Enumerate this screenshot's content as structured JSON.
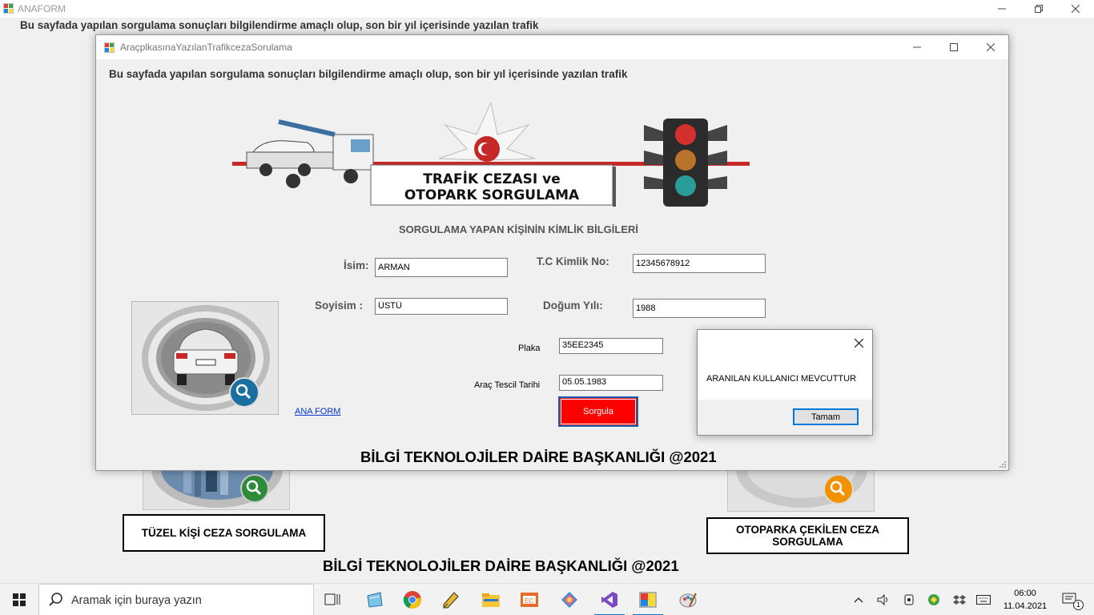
{
  "parent_window": {
    "title": "ANAFORM",
    "description": "Bu sayfada yapılan sorgulama sonuçları bilgilendirme amaçlı olup, son bir yıl içerisinde yazılan trafik",
    "tiles": {
      "tuzel_label": "TÜZEL KİŞİ CEZA SORGULAMA",
      "otopark_label": "OTOPARKA ÇEKİLEN CEZA SORGULAMA"
    },
    "footer": "BİLGİ TEKNOLOJİLER DAİRE BAŞKANLIĞI @2021"
  },
  "child_window": {
    "title": "AraçplkasınaYazılanTrafikcezaSorulama",
    "description": "Bu sayfada yapılan sorgulama sonuçları bilgilendirme amaçlı olup, son bir yıl içerisinde yazılan trafik",
    "banner": {
      "line1": "TRAFİK CEZASI ve",
      "line2": "OTOPARK SORGULAMA"
    },
    "section_title": "SORGULAMA YAPAN KİŞİNİN KİMLİK BİLGİLERİ",
    "form": {
      "isim_label": "İsim:",
      "isim_value": "ARMAN",
      "tc_label": "T.C Kimlik No:",
      "tc_value": "12345678912",
      "soyisim_label": "Soyisim :",
      "soyisim_value": "ÜSTÜ",
      "dogum_label": "Doğum Yılı:",
      "dogum_value": "1988",
      "plaka_label": "Plaka",
      "plaka_value": "35EE2345",
      "tescil_label": "Araç Tescil Tarihi",
      "tescil_value": "05.05.1983"
    },
    "ana_form_link": "ANA FORM",
    "sorgula_button": "Sorgula",
    "footer": "BİLGİ TEKNOLOJİLER DAİRE BAŞKANLIĞI @2021"
  },
  "message_box": {
    "text": "ARANILAN KULLANICI MEVCUTTUR",
    "ok_button": "Tamam"
  },
  "taskbar": {
    "search_placeholder": "Aramak için buraya yazın",
    "apps": [
      "task-view",
      "notepad",
      "chrome",
      "edit-tool",
      "file-explorer",
      "presentation",
      "toolbox",
      "visual-studio",
      "winforms-app",
      "paint"
    ],
    "time": "06:00",
    "date": "11.04.2021",
    "notification_count": "1"
  },
  "colors": {
    "sorgula_red": "#ff0000",
    "focus_blue": "#1464b4",
    "link_blue": "#0033cc"
  }
}
